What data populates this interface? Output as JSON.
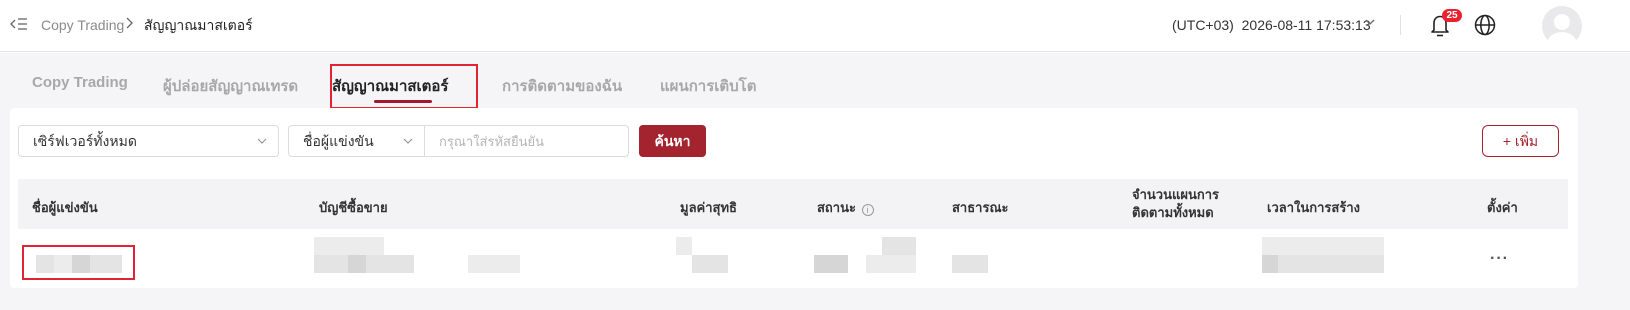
{
  "header": {
    "breadcrumb": [
      "Copy Trading",
      "สัญญาณมาสเตอร์"
    ],
    "timezone": "(UTC+03)",
    "datetime": "2026-08-11 17:53:13",
    "notification_count": "25"
  },
  "tabs": [
    {
      "label": "Copy Trading"
    },
    {
      "label": "ผู้ปล่อยสัญญาณเทรด"
    },
    {
      "label": "สัญญาณมาสเตอร์",
      "active": true
    },
    {
      "label": "การติดตามของฉัน"
    },
    {
      "label": "แผนการเติบโต"
    }
  ],
  "filters": {
    "server_select": "เซิร์ฟเวอร์ทั้งหมด",
    "field_select": "ชื่อผู้แข่งขัน",
    "search_placeholder": "กรุณาใส่รหัสยืนยัน",
    "search_button": "ค้นหา",
    "add_button": "เพิ่ม"
  },
  "table": {
    "columns": [
      "ชื่อผู้แข่งขัน",
      "บัญชีซื้อขาย",
      "มูลค่าสุทธิ",
      "สถานะ",
      "สาธารณะ",
      "จำนวนแผนการติดตามทั้งหมด",
      "เวลาในการสร้าง",
      "ตั้งค่า"
    ],
    "row_actions": "···"
  },
  "colors": {
    "accent": "#a3232e",
    "highlight": "#e02434",
    "badge": "#e8232f"
  }
}
